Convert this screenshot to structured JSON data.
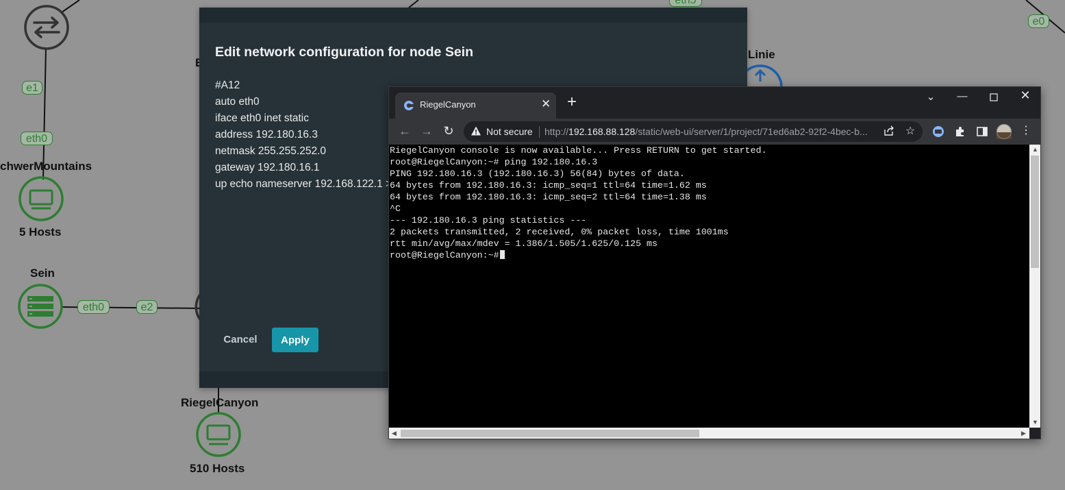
{
  "topology": {
    "nodes": [
      {
        "id": "schwermountains",
        "label": "chwerMountains",
        "sublabel": "5 Hosts"
      },
      {
        "id": "sein",
        "label": "Sein"
      },
      {
        "id": "riegelcanyon",
        "label": "RiegelCanyon",
        "sublabel": "510 Hosts"
      },
      {
        "id": "linie",
        "label": "Linie"
      },
      {
        "id": "partial_b",
        "label": "E"
      }
    ],
    "port_tags": [
      "e1",
      "eth0",
      "eth0",
      "e2",
      "e0",
      "eth5"
    ],
    "colors": {
      "canvas": "#949494",
      "node_green": "#2e7d32",
      "switch": "#333333",
      "router_blue": "#1f5ea8"
    }
  },
  "dialog": {
    "title": "Edit network configuration for node Sein",
    "config_lines": [
      "#A12",
      "auto eth0",
      "iface eth0 inet static",
      "address 192.180.16.3",
      "netmask 255.255.252.0",
      "gateway 192.180.16.1",
      "up echo nameserver 192.168.122.1 >"
    ],
    "cancel_label": "Cancel",
    "apply_label": "Apply",
    "colors": {
      "background": "#263238",
      "apply": "#1795a9"
    }
  },
  "browser": {
    "tab_title": "RiegelCanyon",
    "security_label": "Not secure",
    "url_host": "192.168.88.128",
    "url_prefix": "http://",
    "url_path": "/static/web-ui/server/1/project/71ed6ab2-92f2-4bec-b...",
    "console_lines": [
      "RiegelCanyon console is now available... Press RETURN to get started.",
      "root@RiegelCanyon:~# ping 192.180.16.3",
      "PING 192.180.16.3 (192.180.16.3) 56(84) bytes of data.",
      "64 bytes from 192.180.16.3: icmp_seq=1 ttl=64 time=1.62 ms",
      "64 bytes from 192.180.16.3: icmp_seq=2 ttl=64 time=1.38 ms",
      "^C",
      "--- 192.180.16.3 ping statistics ---",
      "2 packets transmitted, 2 received, 0% packet loss, time 1001ms",
      "rtt min/avg/max/mdev = 1.386/1.505/1.625/0.125 ms",
      "root@RiegelCanyon:~# "
    ],
    "icons": [
      "back-icon",
      "forward-icon",
      "reload-icon",
      "warning-icon",
      "share-icon",
      "star-icon",
      "extension-icon",
      "puzzle-icon",
      "side-panel-icon",
      "profile-icon",
      "menu-icon"
    ]
  }
}
